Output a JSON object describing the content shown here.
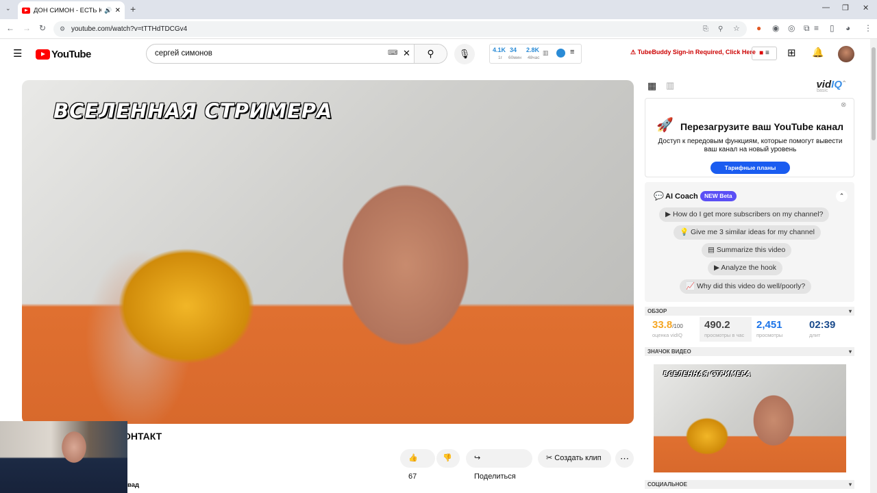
{
  "browser": {
    "tab_title": "ДОН СИМОН - ЕСТЬ КОНТАКТ",
    "new_tab_icon": "plus-icon",
    "url": "youtube.com/watch?v=tTTHdTDCGv4"
  },
  "youtube": {
    "logo_text": "YouTube",
    "search_query": "сергей симонов",
    "stats": {
      "a_value": "4.1K",
      "a_sub": "1г",
      "b_value": "34",
      "b_sub": "60мин",
      "c_value": "2.8K",
      "c_sub": "48час"
    },
    "tubebuddy_notice": "TubeBuddy Sign-in Required, Click Here"
  },
  "video": {
    "overlay_text": "ВСЕЛЕННАЯ СТРИМЕРА",
    "title_fragment": "ОНТАКТ",
    "likes": "67",
    "share_label": "Поделиться",
    "clip_label": "Создать клип",
    "below_fragment": "вад"
  },
  "vidiq": {
    "logo_text": "vid",
    "logo_accent": "IQ",
    "logo_sub": "basic",
    "promo_heading": "Перезагрузите ваш YouTube канал",
    "promo_desc": "Доступ к передовым функциям, которые помогут вывести ваш канал на новый уровень",
    "promo_button": "Тарифные планы",
    "ai_coach_title": "AI Coach",
    "ai_coach_badge": "NEW Beta",
    "questions": [
      "How do I get more subscribers on my channel?",
      "Give me 3 similar ideas for my channel",
      "Summarize this video",
      "Analyze the hook",
      "Why did this video do well/poorly?"
    ],
    "overview_label": "ОБЗОР",
    "score_value": "33.8",
    "score_max": "/100",
    "score_label": "оценка vidIQ",
    "views_per_hour_value": "490.2",
    "views_per_hour_label": "просмотры в час",
    "views_value": "2,451",
    "views_label": "просмотры",
    "duration_value": "02:39",
    "duration_label": "длит",
    "thumbnail_label": "ЗНАЧОК ВИДЕО",
    "thumb_overlay_text": "ВСЕЛЕННАЯ СТРИМЕРА",
    "social_label": "СОЦИАЛЬНОЕ"
  },
  "colors": {
    "youtube_red": "#ff0000",
    "vidiq_blue": "#1a5cf0",
    "score_orange": "#f5a623",
    "metric_blue": "#1a73e8"
  }
}
